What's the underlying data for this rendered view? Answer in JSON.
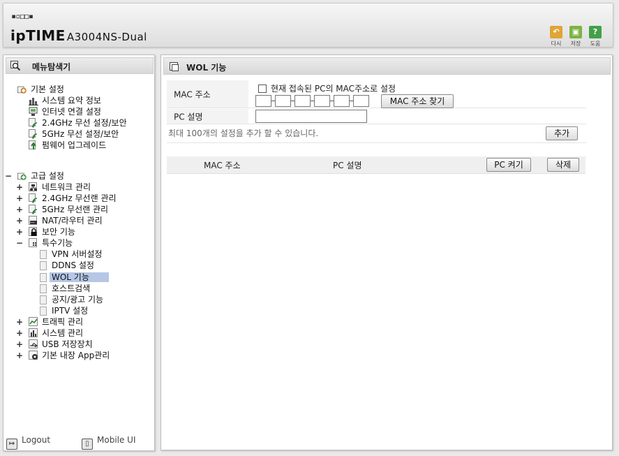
{
  "header": {
    "logo_dots": "▪▫◻◻▪",
    "brand": "ipTIME",
    "model": "A3004NS-Dual",
    "buttons": [
      {
        "label": "다시",
        "icon": "undo-icon",
        "color": "#e0a537"
      },
      {
        "label": "저장",
        "icon": "save-icon",
        "color": "#7cb342"
      },
      {
        "label": "도움",
        "icon": "help-icon",
        "color": "#43a047",
        "glyph": "?"
      }
    ]
  },
  "sidebar": {
    "title": "메뉴탐색기",
    "basic": {
      "label": "기본 설정",
      "items": [
        "시스템 요약 정보",
        "인터넷 연결 설정",
        "2.4GHz 무선 설정/보안",
        "5GHz 무선 설정/보안",
        "펌웨어 업그레이드"
      ]
    },
    "advanced": {
      "label": "고급 설정",
      "items": [
        "네트워크 관리",
        "2.4GHz 무선랜 관리",
        "5GHz 무선랜 관리",
        "NAT/라우터 관리",
        "보안 기능",
        "특수기능"
      ],
      "special_items": [
        "VPN 서버설정",
        "DDNS 설정",
        "WOL 기능",
        "호스트검색",
        "공지/광고 기능",
        "IPTV 설정"
      ],
      "items_after": [
        "트래픽 관리",
        "시스템 관리",
        "USB 저장장치",
        "기본 내장 App관리"
      ]
    },
    "footer": {
      "logout": "Logout",
      "mobile": "Mobile UI"
    }
  },
  "main": {
    "title": "WOL 기능",
    "mac_label": "MAC 주소",
    "current_pc_checkbox": "현재 접속된 PC의 MAC주소로 설정",
    "find_mac_button": "MAC 주소 찾기",
    "pc_desc_label": "PC 설명",
    "pc_desc_value": "",
    "max_note": "최대 100개의 설정을 추가 할 수 있습니다.",
    "add_button": "추가",
    "list_headers": {
      "mac": "MAC 주소",
      "desc": "PC 설명"
    },
    "wake_button": "PC 켜기",
    "delete_button": "삭제"
  }
}
